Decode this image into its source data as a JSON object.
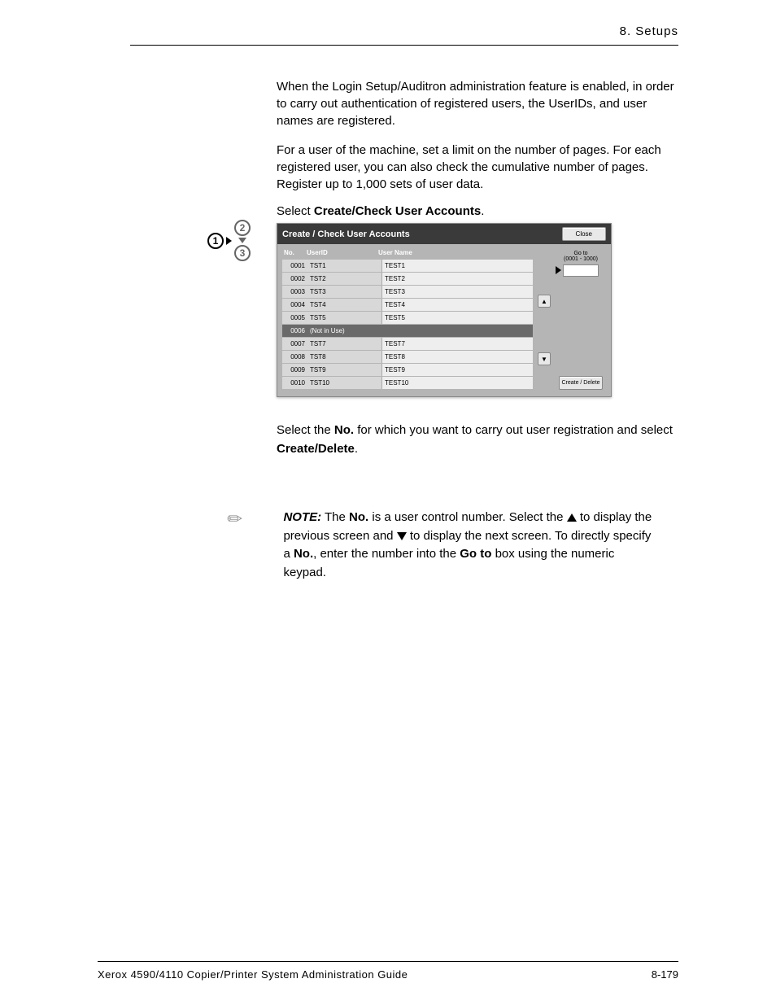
{
  "header": {
    "section": "8. Setups"
  },
  "intro": {
    "p1": "When the Login Setup/Auditron administration feature is enabled, in order to carry out authentication of registered users, the UserIDs, and user names are registered.",
    "p2": "For a user of the machine, set a limit on the number of pages. For each registered user, you can also check the cumulative number of pages. Register up to 1,000 sets of user data."
  },
  "step1": {
    "select_prefix": "Select ",
    "select_bold": "Create/Check User Accounts",
    "select_suffix": "."
  },
  "screenshot": {
    "title": "Create / Check User Accounts",
    "close": "Close",
    "columns": {
      "no": "No.",
      "userid": "UserID",
      "username": "User Name"
    },
    "rows": [
      {
        "no": "0001",
        "uid": "TST1",
        "name": "TEST1",
        "sel": false
      },
      {
        "no": "0002",
        "uid": "TST2",
        "name": "TEST2",
        "sel": false
      },
      {
        "no": "0003",
        "uid": "TST3",
        "name": "TEST3",
        "sel": false
      },
      {
        "no": "0004",
        "uid": "TST4",
        "name": "TEST4",
        "sel": false
      },
      {
        "no": "0005",
        "uid": "TST5",
        "name": "TEST5",
        "sel": false
      },
      {
        "no": "0006",
        "uid": "(Not in Use)",
        "name": "",
        "sel": true
      },
      {
        "no": "0007",
        "uid": "TST7",
        "name": "TEST7",
        "sel": false
      },
      {
        "no": "0008",
        "uid": "TST8",
        "name": "TEST8",
        "sel": false
      },
      {
        "no": "0009",
        "uid": "TST9",
        "name": "TEST9",
        "sel": false
      },
      {
        "no": "0010",
        "uid": "TST10",
        "name": "TEST10",
        "sel": false
      }
    ],
    "goto_label": "Go to",
    "goto_range": "(0001 - 1000)",
    "create_delete": "Create / Delete"
  },
  "step2": {
    "line1_a": "Select the ",
    "line1_bold1": "No.",
    "line1_b": " for which you want to carry out user registration and select ",
    "line1_bold2": "Create/Delete",
    "line1_c": "."
  },
  "note": {
    "label": "NOTE:",
    "text_a": " The ",
    "bold_no": "No.",
    "text_b": " is a user control number. Select the ",
    "text_c": " to display the previous screen and ",
    "text_d": " to display the next screen. To directly specify a ",
    "bold_no2": "No.",
    "text_e": ", enter the number into the ",
    "bold_goto": "Go to",
    "text_f": " box using the numeric keypad."
  },
  "footer": {
    "left": "Xerox 4590/4110 Copier/Printer System Administration Guide",
    "right": "8-179"
  }
}
